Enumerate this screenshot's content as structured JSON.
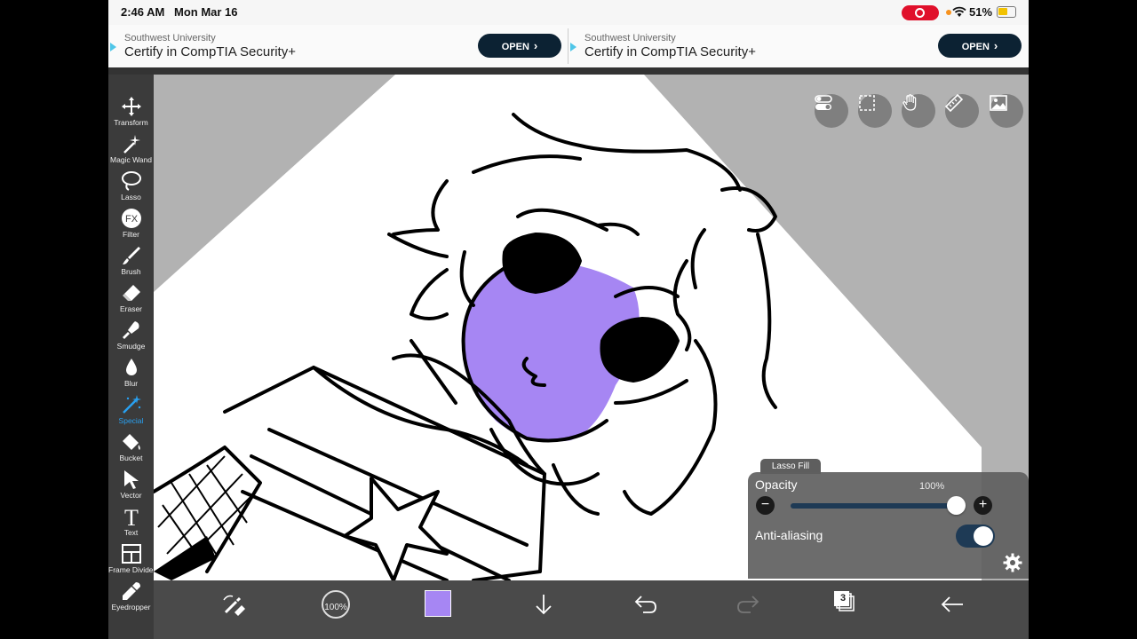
{
  "status_bar": {
    "time": "2:46 AM",
    "date": "Mon Mar 16",
    "battery": "51%"
  },
  "ads": [
    {
      "brand": "Southwest University",
      "headline": "Certify in CompTIA Security+",
      "cta": "OPEN"
    },
    {
      "brand": "Southwest University",
      "headline": "Certify in CompTIA Security+",
      "cta": "OPEN"
    }
  ],
  "toolbar": {
    "tools": [
      {
        "label": "Transform",
        "icon": "move-arrows-icon"
      },
      {
        "label": "Magic Wand",
        "icon": "magic-wand-icon"
      },
      {
        "label": "Lasso",
        "icon": "lasso-icon"
      },
      {
        "label": "Filter",
        "icon": "fx-icon",
        "glyph": "FX"
      },
      {
        "label": "Brush",
        "icon": "brush-icon"
      },
      {
        "label": "Eraser",
        "icon": "eraser-icon"
      },
      {
        "label": "Smudge",
        "icon": "smudge-icon"
      },
      {
        "label": "Blur",
        "icon": "blur-drop-icon"
      },
      {
        "label": "Special",
        "icon": "special-wand-icon",
        "active": true
      },
      {
        "label": "Bucket",
        "icon": "bucket-icon"
      },
      {
        "label": "Vector",
        "icon": "vector-pointer-icon"
      },
      {
        "label": "Text",
        "icon": "text-icon",
        "glyph": "T"
      },
      {
        "label": "Frame Divider",
        "icon": "frame-divider-icon"
      },
      {
        "label": "Eyedropper",
        "icon": "eyedropper-icon"
      }
    ]
  },
  "top_buttons": [
    "toggles-icon",
    "selection-icon",
    "hand-icon",
    "ruler-icon",
    "image-icon"
  ],
  "lasso_fill": {
    "title": "Lasso Fill",
    "opacity_label": "Opacity",
    "opacity_value": "100%",
    "opacity": 1.0,
    "minus": "−",
    "plus": "+",
    "antialiasing_label": "Anti-aliasing",
    "antialiasing_on": true
  },
  "bottom_bar": {
    "brush_size": "100%",
    "color": "#a686f3",
    "layers": "3"
  },
  "colors": {
    "toolbar_bg": "#3b3b3b",
    "accent": "#29a0f0",
    "paint_purple": "#a686f3"
  }
}
